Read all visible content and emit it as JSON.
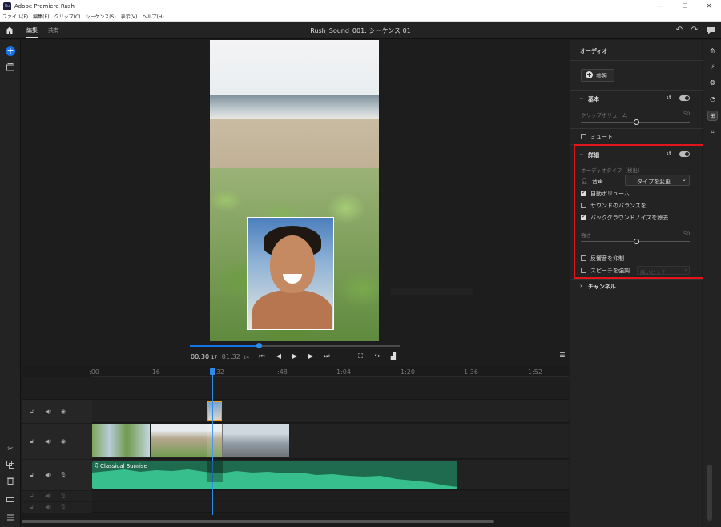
{
  "window": {
    "title": "Adobe Premiere Rush",
    "minimize": "—",
    "maximize": "☐",
    "close": "✕"
  },
  "menu": [
    "ファイル(F)",
    "編集(E)",
    "クリップ(C)",
    "シーケンス(S)",
    "表示(V)",
    "ヘルプ(H)"
  ],
  "topbar": {
    "tab_edit": "編集",
    "tab_share": "共有",
    "project_title": "Rush_Sound_001: シーケンス 01"
  },
  "player": {
    "current_time": "00:30",
    "current_frames": "17",
    "duration": "01:32",
    "duration_frames": "14",
    "progress": 0.33
  },
  "ruler": [
    ":00",
    ":16",
    ":32",
    ":48",
    "1:04",
    "1:20",
    "1:36",
    "1:52"
  ],
  "audio_clip": {
    "name": "Classical Sunrise"
  },
  "panel": {
    "title": "オーディオ",
    "browse": "参照",
    "basic": {
      "heading": "基本",
      "clip_volume_label": "クリップボリューム",
      "clip_volume_value": "50",
      "mute": "ミュート"
    },
    "advanced": {
      "heading": "詳細",
      "audio_type_label": "オーディオタイプ（検出）",
      "voice": "音声",
      "change_type": "タイプを変更",
      "auto_volume": "自動ボリューム",
      "balance_sound": "サウンドのバランスを...",
      "remove_noise": "バックグラウンドノイズを除去",
      "strength_label": "強さ",
      "strength_value": "50",
      "reduce_reverb": "反響音を抑制",
      "enhance_speech": "スピーチを強調",
      "pitch": "高いピッチ"
    },
    "channels": "チャンネル"
  },
  "state": {
    "auto_volume": true,
    "balance_sound": false,
    "remove_noise": true,
    "reduce_reverb": false,
    "enhance_speech": false,
    "mute": false,
    "clip_volume": 50,
    "strength": 50
  },
  "colors": {
    "accent": "#1473e6",
    "highlight": "#e4141b",
    "audio": "#2fa87a"
  }
}
